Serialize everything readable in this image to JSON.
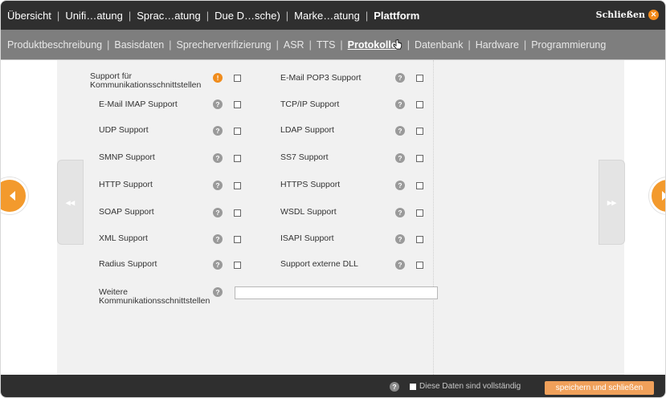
{
  "topnav": {
    "items": [
      "Übersicht",
      "Unifi…atung",
      "Sprac…atung",
      "Due D…sche)",
      "Marke…atung",
      "Plattform"
    ],
    "active_index": 5,
    "close_label": "Schließen"
  },
  "subnav": {
    "items": [
      "Produktbeschreibung",
      "Basisdaten",
      "Sprecherverifizierung",
      "ASR",
      "TTS",
      "Protokolle",
      "Datenbank",
      "Hardware",
      "Programmierung"
    ],
    "active_index": 5
  },
  "form": {
    "left": [
      {
        "label": "Support für Kommunikationsschnittstellen",
        "help_icon": "exclamation-icon",
        "checked": false
      },
      {
        "label": "E-Mail IMAP Support",
        "help_icon": "question-icon",
        "checked": false
      },
      {
        "label": "UDP Support",
        "help_icon": "question-icon",
        "checked": false
      },
      {
        "label": "SMNP Support",
        "help_icon": "question-icon",
        "checked": false
      },
      {
        "label": "HTTP Support",
        "help_icon": "question-icon",
        "checked": false
      },
      {
        "label": "SOAP Support",
        "help_icon": "question-icon",
        "checked": false
      },
      {
        "label": "XML Support",
        "help_icon": "question-icon",
        "checked": false
      },
      {
        "label": "Radius Support",
        "help_icon": "question-icon",
        "checked": false
      }
    ],
    "right": [
      {
        "label": "E-Mail POP3 Support",
        "help_icon": "question-icon",
        "checked": false
      },
      {
        "label": "TCP/IP Support",
        "help_icon": "question-icon",
        "checked": false
      },
      {
        "label": "LDAP Support",
        "help_icon": "question-icon",
        "checked": false
      },
      {
        "label": "SS7 Support",
        "help_icon": "question-icon",
        "checked": false
      },
      {
        "label": "HTTPS Support",
        "help_icon": "question-icon",
        "checked": false
      },
      {
        "label": "WSDL Support",
        "help_icon": "question-icon",
        "checked": false
      },
      {
        "label": "ISAPI Support",
        "help_icon": "question-icon",
        "checked": false
      },
      {
        "label": "Support externe DLL",
        "help_icon": "question-icon",
        "checked": false
      }
    ],
    "further_label": "Weitere Kommunikationsschnittstellen",
    "further_value": ""
  },
  "footer": {
    "complete_label": "Diese Daten sind vollständig",
    "save_label": "speichern und schließen"
  },
  "colors": {
    "accent": "#f39a2d",
    "topnav_bg": "#2f2f2f",
    "subnav_bg": "#7e7e7e",
    "panel_bg": "#f1f1f1"
  }
}
